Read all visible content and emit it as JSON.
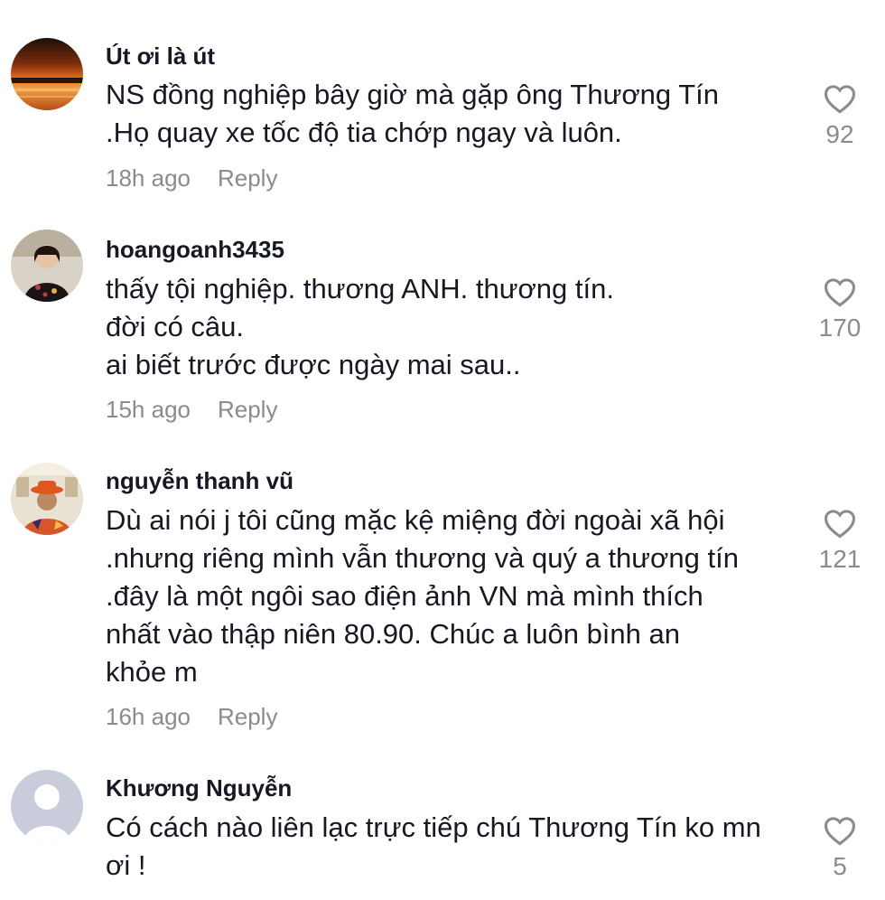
{
  "comments": [
    {
      "username": "Út ơi là út",
      "lines": [
        "NS đồng nghiệp bây giờ mà gặp ông Thương Tín",
        ".Họ quay xe tốc độ tia chớp ngay và luôn."
      ],
      "time": "18h ago",
      "reply": "Reply",
      "likes": "92",
      "avatar": "sunset-photo"
    },
    {
      "username": "hoangoanh3435",
      "lines": [
        "thấy tội nghiệp. thương ANH. thương tín.",
        "đời có câu.",
        "ai biết trước được ngày mai sau.."
      ],
      "time": "15h ago",
      "reply": "Reply",
      "likes": "170",
      "avatar": "woman-photo"
    },
    {
      "username": "nguyễn thanh vũ",
      "lines": [
        "Dù ai nói j tôi cũng mặc kệ miệng đời ngoài xã hội",
        ".nhưng riêng mình vẫn thương và quý a thương tín",
        ".đây là một ngôi sao điện ảnh VN mà mình thích",
        "nhất vào thập niên 80.90. Chúc a luôn bình an",
        "khỏe m"
      ],
      "time": "16h ago",
      "reply": "Reply",
      "likes": "121",
      "avatar": "man-hat-photo"
    },
    {
      "username": "Khương Nguyễn",
      "lines": [
        "Có cách nào liên lạc trực tiếp chú Thương Tín ko mn",
        "ơi !"
      ],
      "time": "",
      "reply": "",
      "likes": "5",
      "avatar": "default-avatar"
    }
  ],
  "colors": {
    "text": "#161823",
    "muted": "#8a8b91",
    "default_avatar_bg": "#c9cddb"
  }
}
